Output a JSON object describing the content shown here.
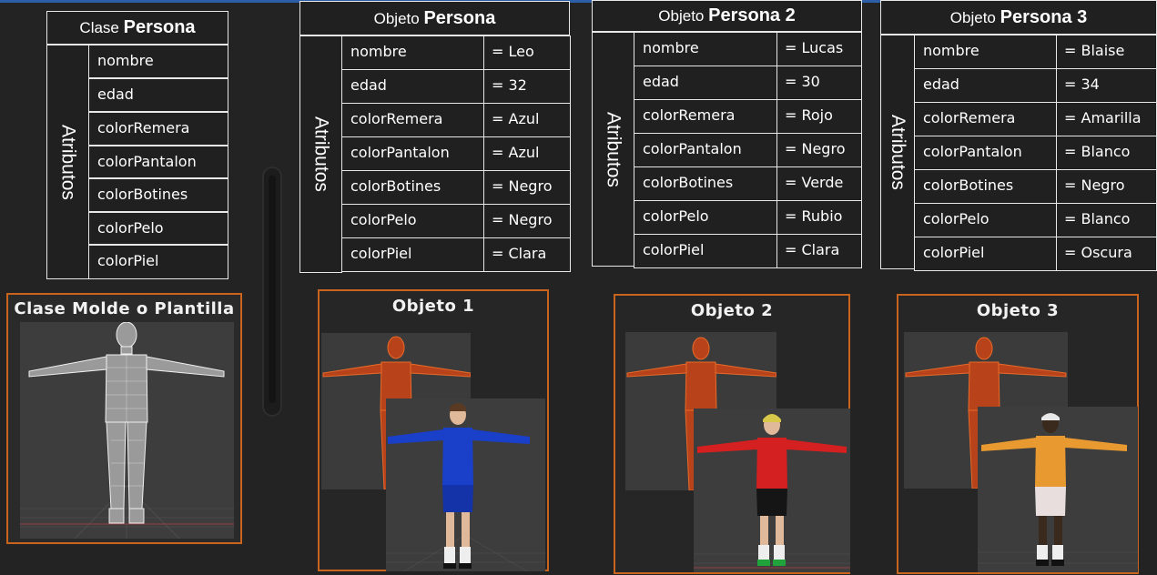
{
  "class_table": {
    "title_prefix": "Clase",
    "title_name": "Persona",
    "section_label": "Atributos",
    "attributes": [
      "nombre",
      "edad",
      "colorRemera",
      "colorPantalon",
      "colorBotines",
      "colorPelo",
      "colorPiel"
    ]
  },
  "objects": [
    {
      "title_prefix": "Objeto",
      "title_name": "Persona",
      "section_label": "Atributos",
      "attributes": [
        "nombre",
        "edad",
        "colorRemera",
        "colorPantalon",
        "colorBotines",
        "colorPelo",
        "colorPiel"
      ],
      "values": [
        "= Leo",
        "= 32",
        "= Azul",
        "= Azul",
        "= Negro",
        "= Negro",
        "= Clara"
      ]
    },
    {
      "title_prefix": "Objeto",
      "title_name": "Persona 2",
      "section_label": "Atributos",
      "attributes": [
        "nombre",
        "edad",
        "colorRemera",
        "colorPantalon",
        "colorBotines",
        "colorPelo",
        "colorPiel"
      ],
      "values": [
        "= Lucas",
        "= 30",
        "= Rojo",
        "= Negro",
        "= Verde",
        "= Rubio",
        "= Clara"
      ]
    },
    {
      "title_prefix": "Objeto",
      "title_name": "Persona 3",
      "section_label": "Atributos",
      "attributes": [
        "nombre",
        "edad",
        "colorRemera",
        "colorPantalon",
        "colorBotines",
        "colorPelo",
        "colorPiel"
      ],
      "values": [
        "= Blaise",
        "= 34",
        "= Amarilla",
        "= Blanco",
        "= Negro",
        "= Blanco",
        "= Oscura"
      ]
    }
  ],
  "panels": [
    {
      "title": "Clase Molde o Plantilla"
    },
    {
      "title": "Objeto 1"
    },
    {
      "title": "Objeto 2"
    },
    {
      "title": "Objeto 3"
    }
  ],
  "colors": {
    "frame_border": "#c8641e",
    "wireframe_template": "#e6e6e6",
    "wireframe_object": "#e05a1a",
    "shirt_obj1": "#1a3fc8",
    "pants_obj1": "#1a3fc8",
    "shirt_obj2": "#d42020",
    "pants_obj2": "#151515",
    "boots_obj2": "#1fa33a",
    "hair_obj2": "#d8c84a",
    "shirt_obj3": "#e89a30",
    "pants_obj3": "#e8dede",
    "skin_obj3": "#3a2a1e",
    "skin_light": "#e0b89a"
  }
}
